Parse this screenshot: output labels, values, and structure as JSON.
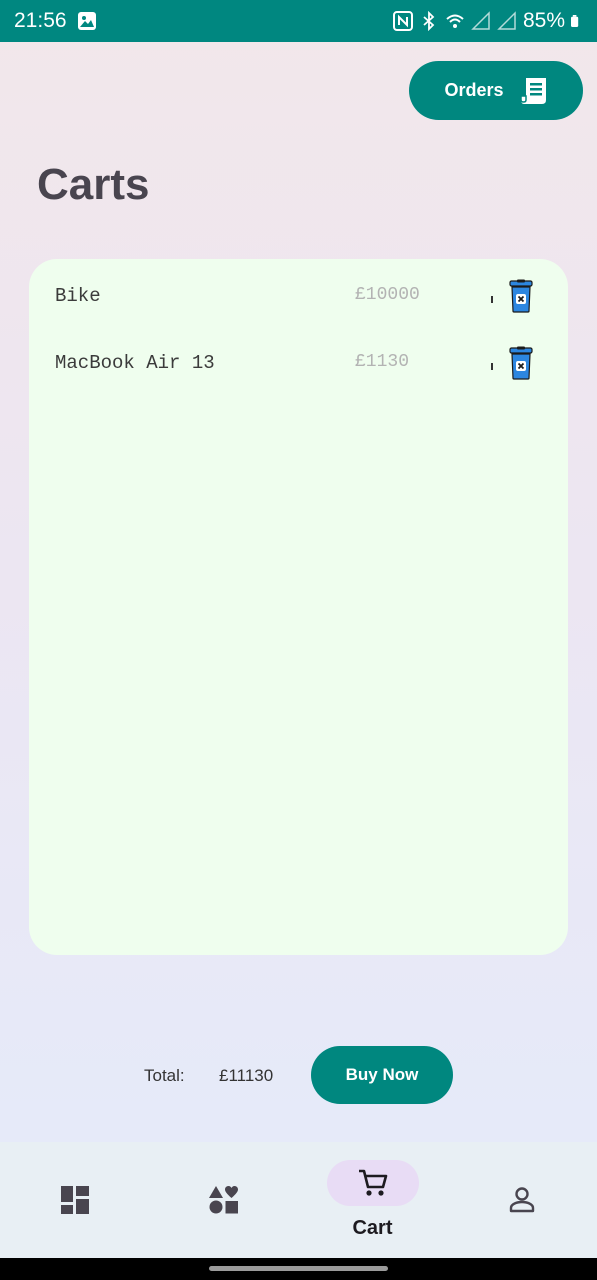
{
  "status_bar": {
    "time": "21:56",
    "battery": "85%",
    "icons": [
      "gallery-icon",
      "nfc-icon",
      "bluetooth-icon",
      "wifi-icon",
      "signal-icon",
      "signal-icon",
      "battery-icon"
    ]
  },
  "header": {
    "orders_label": "Orders",
    "orders_icon": "receipt-icon"
  },
  "page": {
    "title": "Carts"
  },
  "cart": {
    "items": [
      {
        "name": "Bike",
        "price": "£10000",
        "delete_icon": "trash-icon"
      },
      {
        "name": "MacBook Air 13",
        "price": "£1130",
        "delete_icon": "trash-icon"
      }
    ]
  },
  "checkout": {
    "total_label": "Total:",
    "total_value": "£11130",
    "buy_label": "Buy Now"
  },
  "bottom_nav": {
    "items": [
      {
        "icon": "dashboard-icon",
        "label": ""
      },
      {
        "icon": "categories-icon",
        "label": ""
      },
      {
        "icon": "cart-icon",
        "label": "Cart",
        "active": true
      },
      {
        "icon": "person-icon",
        "label": ""
      }
    ]
  },
  "colors": {
    "primary": "#00877f",
    "card_bg": "#effeee",
    "delete_icon": "#2c86e0",
    "active_nav_pill": "#e8dcf5"
  }
}
